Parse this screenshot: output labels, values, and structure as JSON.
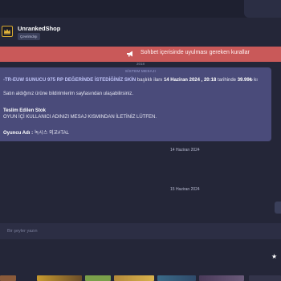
{
  "shop": {
    "name": "UnrankedShop",
    "status": "Çevrimdışı"
  },
  "banner": {
    "text": "Sohbet içerisinde uyulması gereken kurallar",
    "icon": "megaphone-icon"
  },
  "dates": {
    "top": "2018",
    "first": "14 Haziran 2024",
    "second": "15 Haziran 2024"
  },
  "system_message": {
    "title": "SİSTEM MESAJI",
    "line1_prefix": "-TR-EUW SUNUCU 975 RP DEĞERİNDE İSTEDİĞİNİZ SKİN",
    "line1_mid": " başlıklı ilanı ",
    "line1_date": "14 Haziran 2024 , 20:18",
    "line1_mid2": " tarihinde ",
    "line1_price": "39.99₺",
    "line1_end": " kı",
    "line2": "Satın aldığınız ürüne bildirimlerim sayfasından ulaşabilirsiniz.",
    "delivered_title": "Teslim Edilen Stok",
    "delivered_text": "OYUN İÇİ KULLANICI ADINIZI MESAJ KISMINDAN İLETİNİZ LÜTFEN.",
    "player_label": "Oyuncu Adı :",
    "player_value": " 녹시스 외교#TAL"
  },
  "input": {
    "placeholder": "Bir şeyler yazın"
  },
  "colors": {
    "background": "#242638",
    "banner": "#c95959",
    "card": "#4a4b7a",
    "accent": "#bfc3f7"
  }
}
